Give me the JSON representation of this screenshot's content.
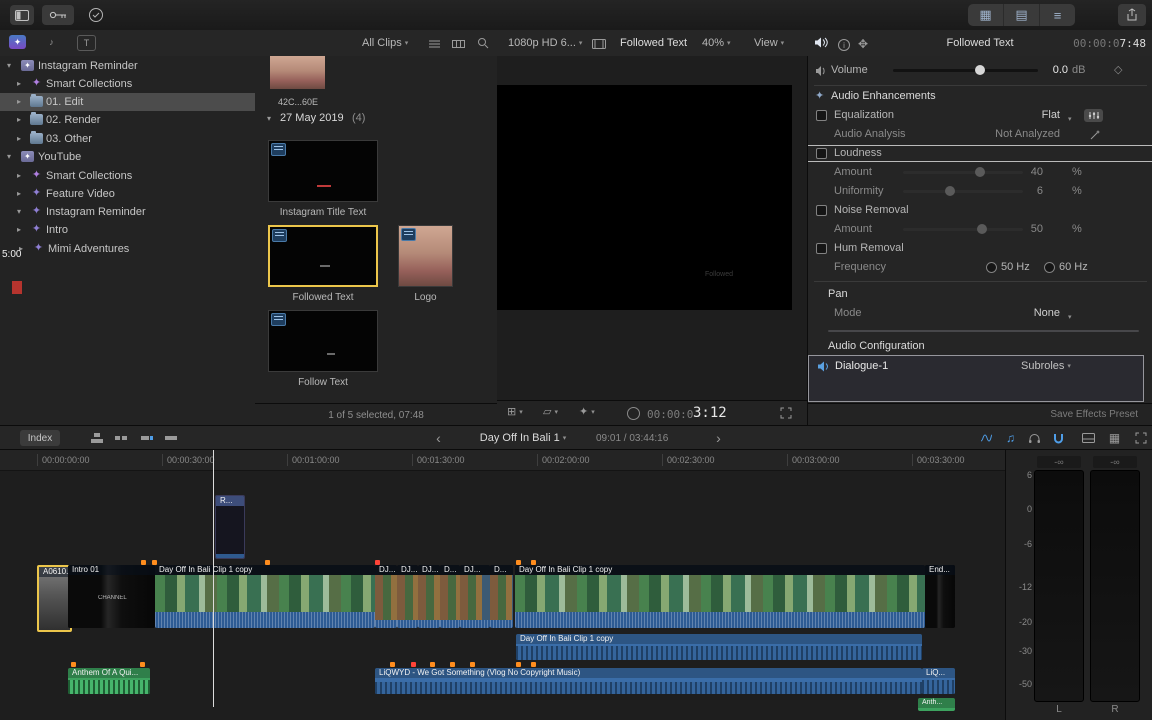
{
  "colors": {
    "accent_blue": "#4f9ee8",
    "selection_yellow": "#ecc64b",
    "timeline_clip_blue": "#3a6da8",
    "audio_green": "#3da35f"
  },
  "icons": {
    "disclosure_open": "▾",
    "disclosure_closed": "▸",
    "dropdown": "▾",
    "back": "‹",
    "forward": "›",
    "grid": "▦",
    "rows": "▤",
    "lines": "≡",
    "star": "✦",
    "diamond": "◇",
    "music": "♫",
    "note": "♪",
    "titles": "T",
    "info_letter": "i",
    "transform": "⊞",
    "crop": "▱",
    "effects": "✦",
    "motion": "✥"
  },
  "browser_toolbar": {
    "all_clips": "All Clips",
    "format_info": "1080p HD 6...",
    "clip_name": "Followed Text",
    "zoom_level": "40%",
    "view_label": "View"
  },
  "inspector": {
    "title": "Followed Text",
    "timecode_dim": "00:00:0",
    "timecode_bright": "7:48",
    "volume_label": "Volume",
    "volume_value": "0.0",
    "volume_unit": "dB",
    "sections": {
      "audio_enhancements": "Audio Enhancements",
      "pan": "Pan",
      "audio_configuration": "Audio Configuration"
    },
    "rows": {
      "equalization": "Equalization",
      "equalization_value": "Flat",
      "audio_analysis": "Audio Analysis",
      "audio_analysis_value": "Not Analyzed",
      "loudness": "Loudness",
      "amount_loudness": "Amount",
      "amount_loudness_value": "40",
      "uniformity": "Uniformity",
      "uniformity_value": "6",
      "noise_removal": "Noise Removal",
      "amount_noise": "Amount",
      "amount_noise_value": "50",
      "hum_removal": "Hum Removal",
      "frequency": "Frequency",
      "freq_50": "50 Hz",
      "freq_60": "60 Hz",
      "mode": "Mode",
      "mode_value": "None",
      "percent": "%"
    },
    "role_row": {
      "name": "Dialogue-1",
      "subroles": "Subroles"
    },
    "save_preset": "Save Effects Preset"
  },
  "sidebar": {
    "items": [
      {
        "label": "Instagram Reminder"
      },
      {
        "label": "Smart Collections"
      },
      {
        "label": "01. Edit"
      },
      {
        "label": "02. Render"
      },
      {
        "label": "03. Other"
      },
      {
        "label": "YouTube"
      },
      {
        "label": "Smart Collections"
      },
      {
        "label": "Feature Video"
      },
      {
        "label": "Instagram Reminder"
      },
      {
        "label": "Intro"
      },
      {
        "label": "Mimi Adventures"
      }
    ],
    "stray_duration": "5:00"
  },
  "browser": {
    "partial_clip_label": "42C...60E",
    "group_date": "27 May 2019",
    "group_count": "(4)",
    "clips": [
      {
        "label": "Instagram Title Text"
      },
      {
        "label": "Followed Text"
      },
      {
        "label": "Logo"
      },
      {
        "label": "Follow Text"
      }
    ],
    "status": "1 of 5 selected, 07:48"
  },
  "viewer": {
    "watermark": "Followed",
    "timecode_dim": "00:00:0",
    "timecode_bright": "3:12"
  },
  "timeline": {
    "toolbar": {
      "index_label": "Index",
      "project_name": "Day Off In Bali 1",
      "project_info": "09:01 / 03:44:16"
    },
    "ruler": [
      "00:00:00:00",
      "00:00:30:00",
      "00:01:00:00",
      "00:01:30:00",
      "00:02:00:00",
      "00:02:30:00",
      "00:03:00:00",
      "00:03:30:00"
    ],
    "clips": {
      "connected_title": "R...",
      "v1": "A0610...",
      "v2": "Intro 01",
      "v2_thumb_text": "CHANNEL",
      "v3": "Day Off In Bali Clip 1 copy",
      "small": [
        "DJ...",
        "DJ...",
        "DJ...",
        "D...",
        "DJ...",
        "D..."
      ],
      "v4": "Day Off In Bali Clip 1 copy",
      "v5": "End...",
      "a1": "Day Off In Bali Clip 1 copy",
      "a2": "Anthem Of A Qui...",
      "a3": "LiQWYD - We Got Something (Vlog No Copyright Music)",
      "a4": "LiQ...",
      "a5": "Anth..."
    }
  },
  "meters": {
    "peak_left": "-∞",
    "peak_right": "-∞",
    "scale": [
      "6",
      "0",
      "-6",
      "-12",
      "-20",
      "-30",
      "-50"
    ],
    "left_label": "L",
    "right_label": "R"
  }
}
